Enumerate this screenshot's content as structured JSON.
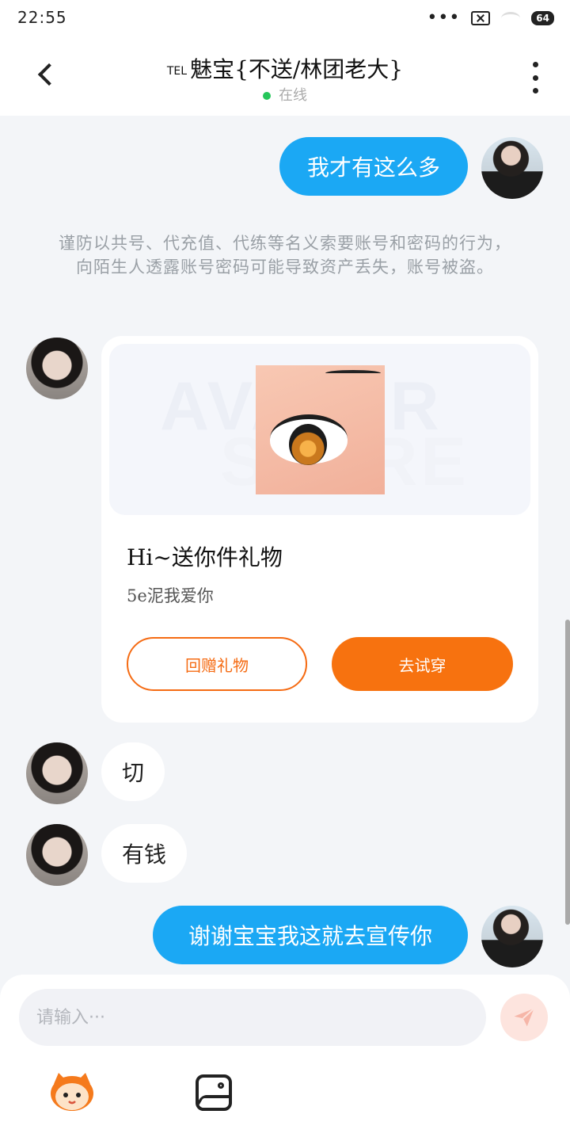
{
  "status_bar": {
    "time": "22:55",
    "more": "•••",
    "battery": "64"
  },
  "header": {
    "title_prefix": "TEL",
    "title": "魅宝{不送/林团老大}",
    "status": "在线"
  },
  "messages": [
    {
      "sender": "self",
      "text": "我才有这么多"
    },
    {
      "sender": "other",
      "type": "gift",
      "title": "Hi~送你件礼物",
      "subtitle": "5e泥我爱你",
      "button_return": "回赠礼物",
      "button_try": "去试穿"
    },
    {
      "sender": "other",
      "text": "切"
    },
    {
      "sender": "other",
      "text": "有钱"
    },
    {
      "sender": "self",
      "text": "谢谢宝宝我这就去宣传你"
    }
  ],
  "notice": "谨防以共号、代充值、代练等名义索要账号和密码的行为，向陌生人透露账号密码可能导致资产丢失，账号被盗。",
  "gift_card": {
    "watermark_line1": "AVATAR",
    "watermark_line2": "STORE"
  },
  "input": {
    "placeholder": "请输入···"
  },
  "icons": {
    "back": "back-arrow-icon",
    "more": "more-vertical-icon",
    "send": "send-icon",
    "emoji": "mascot-emoji-icon",
    "image": "image-icon"
  },
  "colors": {
    "self_bubble": "#1ba8f4",
    "accent_orange": "#f7720f",
    "online_green": "#25c65a",
    "background": "#f3f5f8"
  }
}
